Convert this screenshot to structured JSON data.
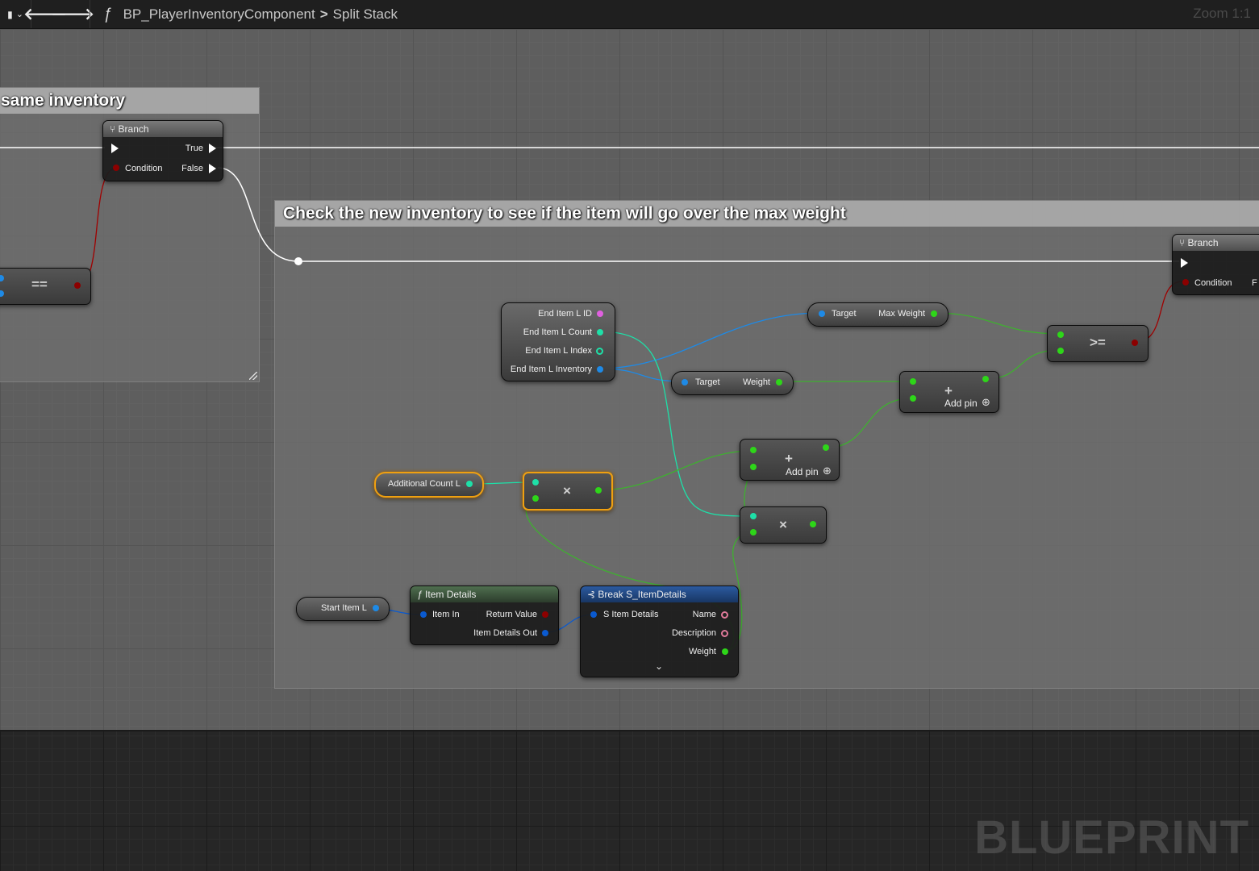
{
  "toolbar": {
    "breadcrumb_function": "BP_PlayerInventoryComponent",
    "breadcrumb_separator": ">",
    "breadcrumb_graph": "Split Stack",
    "zoom": "Zoom 1:1"
  },
  "comments": {
    "same_inventory": "same inventory",
    "max_weight": "Check the new inventory to see if the item will go over the max weight"
  },
  "nodes": {
    "branch1": {
      "title": "Branch",
      "condition": "Condition",
      "true": "True",
      "false": "False"
    },
    "equals": {
      "op": "=="
    },
    "branch2": {
      "title": "Branch",
      "condition": "Condition",
      "false_partial": "F"
    },
    "end_item": {
      "id": "End Item L ID",
      "count": "End Item L Count",
      "index": "End Item L Index",
      "inventory": "End Item L Inventory"
    },
    "max_weight_get": {
      "target": "Target",
      "value": "Max Weight"
    },
    "weight_get": {
      "target": "Target",
      "value": "Weight"
    },
    "gte": {
      "op": ">="
    },
    "add1": {
      "op": "+",
      "add_pin": "Add pin"
    },
    "add2": {
      "op": "+",
      "add_pin": "Add pin"
    },
    "additional_count": {
      "label": "Additional Count L"
    },
    "mul1": {
      "op": "×"
    },
    "mul2": {
      "op": "×"
    },
    "start_item": {
      "label": "Start Item L"
    },
    "item_details": {
      "title": "Item Details",
      "item_in": "Item In",
      "return_value": "Return Value",
      "item_details_out": "Item Details Out"
    },
    "break_details": {
      "title": "Break S_ItemDetails",
      "s_item_details": "S Item Details",
      "name": "Name",
      "description": "Description",
      "weight": "Weight"
    }
  },
  "watermark": "BLUEPRINT",
  "colors": {
    "exec": "#ffffff",
    "bool": "#8c0000",
    "int": "#1ee0a8",
    "float": "#2ed619",
    "object": "#1e8ae6",
    "struct": "#0a5ad0",
    "string": "#e060e0",
    "text": "#e07a9a",
    "selected": "#f0a010"
  }
}
